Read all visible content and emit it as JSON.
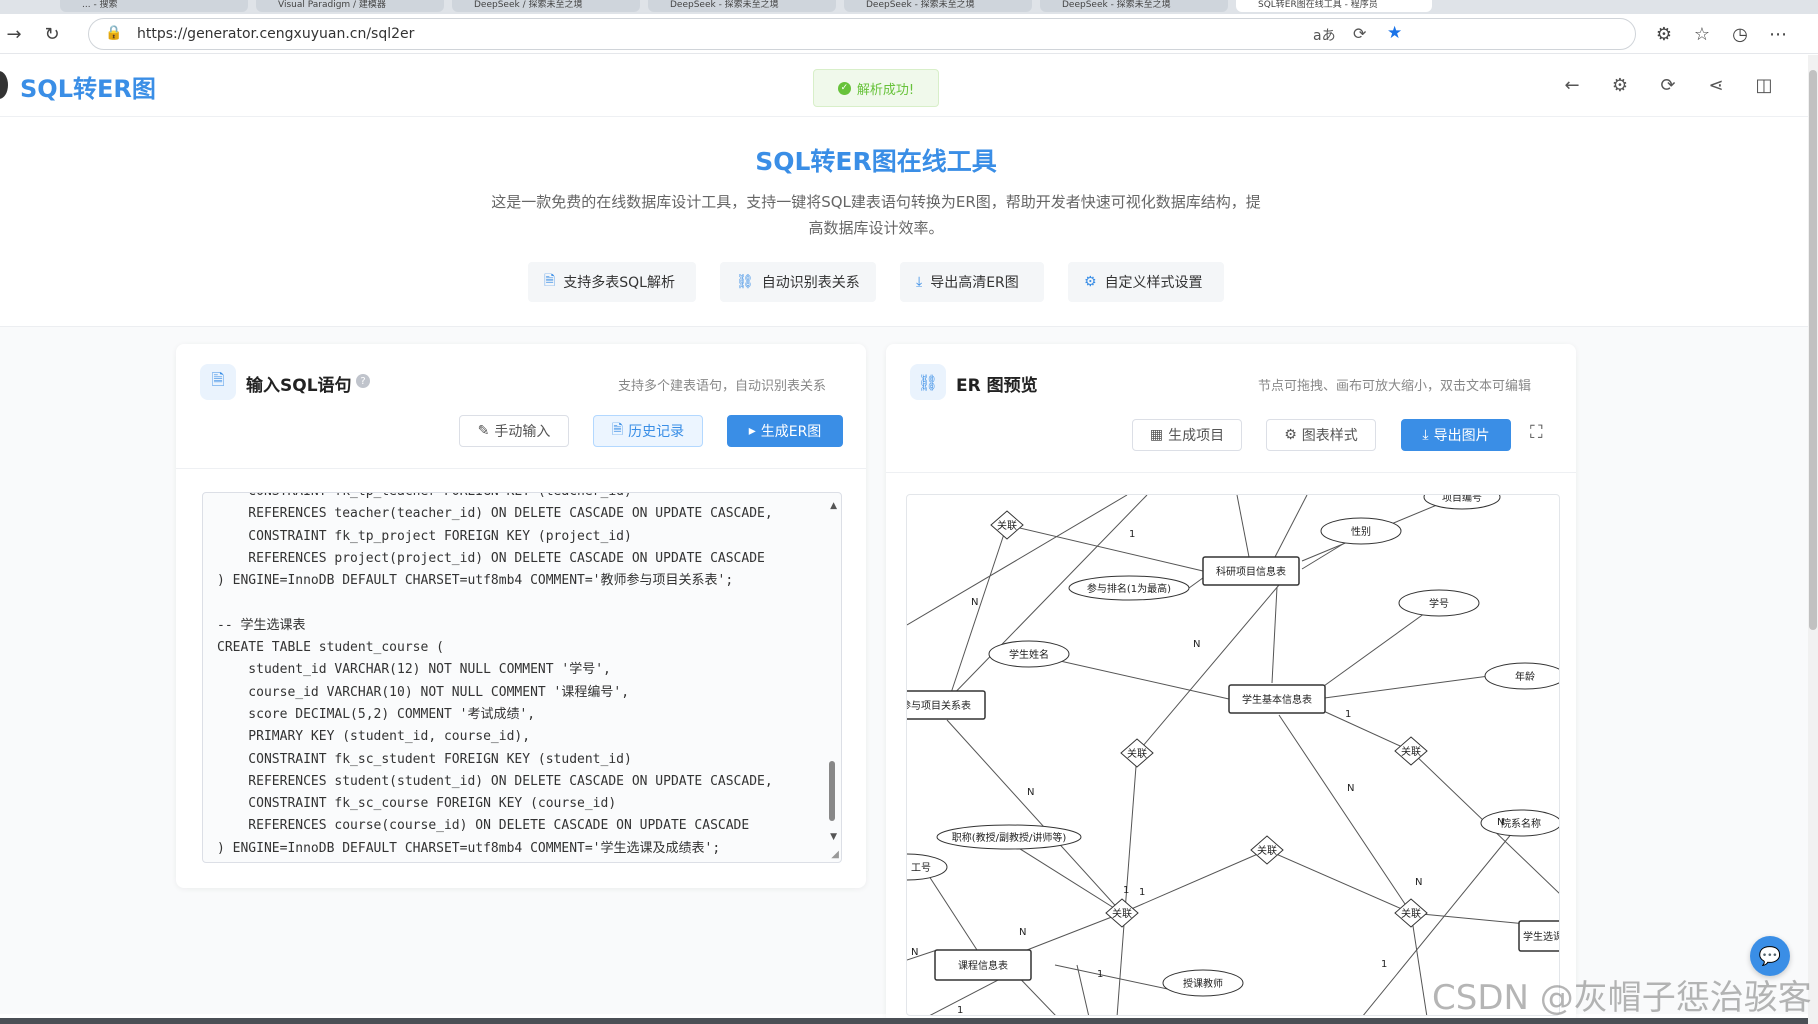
{
  "browser": {
    "tabs": [
      {
        "label": "... - 搜索"
      },
      {
        "label": "Visual Paradigm / 建模器"
      },
      {
        "label": "DeepSeek / 探索未至之境"
      },
      {
        "label": "DeepSeek - 探索未至之境"
      },
      {
        "label": "DeepSeek - 探索未至之境"
      },
      {
        "label": "DeepSeek - 探索未至之境"
      },
      {
        "label": "SQL转ER图在线工具 - 程序员"
      }
    ],
    "url": "https://generator.cengxuyuan.cn/sql2er"
  },
  "header": {
    "logo": "SQL转ER图",
    "toast": "解析成功!"
  },
  "hero": {
    "title": "SQL转ER图在线工具",
    "description": "这是一款免费的在线数据库设计工具，支持一键将SQL建表语句转换为ER图，帮助开发者快速可视化数据库结构，提高数据库设计效率。",
    "features": [
      "支持多表SQL解析",
      "自动识别表关系",
      "导出高清ER图",
      "自定义样式设置"
    ]
  },
  "sql_panel": {
    "title": "输入SQL语句",
    "hint": "支持多个建表语句，自动识别表关系",
    "buttons": {
      "manual": "手动输入",
      "history": "历史记录",
      "generate": "生成ER图"
    },
    "code": "    CONSTRAINT fk_tp_teacher FOREIGN KEY (teacher_id)\n    REFERENCES teacher(teacher_id) ON DELETE CASCADE ON UPDATE CASCADE,\n    CONSTRAINT fk_tp_project FOREIGN KEY (project_id)\n    REFERENCES project(project_id) ON DELETE CASCADE ON UPDATE CASCADE\n) ENGINE=InnoDB DEFAULT CHARSET=utf8mb4 COMMENT='教师参与项目关系表';\n\n-- 学生选课表\nCREATE TABLE student_course (\n    student_id VARCHAR(12) NOT NULL COMMENT '学号',\n    course_id VARCHAR(10) NOT NULL COMMENT '课程编号',\n    score DECIMAL(5,2) COMMENT '考试成绩',\n    PRIMARY KEY (student_id, course_id),\n    CONSTRAINT fk_sc_student FOREIGN KEY (student_id)\n    REFERENCES student(student_id) ON DELETE CASCADE ON UPDATE CASCADE,\n    CONSTRAINT fk_sc_course FOREIGN KEY (course_id)\n    REFERENCES course(course_id) ON DELETE CASCADE ON UPDATE CASCADE\n) ENGINE=InnoDB DEFAULT CHARSET=utf8mb4 COMMENT='学生选课及成绩表';"
  },
  "er_panel": {
    "title": "ER 图预览",
    "hint": "节点可拖拽、画布可放大缩小，双击文本可编辑",
    "buttons": {
      "project": "生成项目",
      "style": "图表样式",
      "export": "导出图片"
    },
    "entities": [
      "科研项目信息表",
      "学生基本信息表",
      "教师参与项目关系表",
      "课程信息表",
      "学生选课"
    ],
    "attributes": [
      "项目编号",
      "性别",
      "参与排名(1为最高)",
      "学号",
      "学生姓名",
      "年龄",
      "院系名称",
      "职称(教授/副教授/讲师等)",
      "工号",
      "授课教师"
    ],
    "relations": [
      "关联",
      "关联",
      "关联",
      "关联",
      "关联",
      "关联",
      "关联"
    ],
    "cardinality": [
      "1",
      "N",
      "N",
      "1",
      "N",
      "N",
      "N",
      "1",
      "1",
      "N",
      "N",
      "1",
      "1",
      "N",
      "1"
    ]
  },
  "watermark": "CSDN @灰帽子惩治骇客"
}
